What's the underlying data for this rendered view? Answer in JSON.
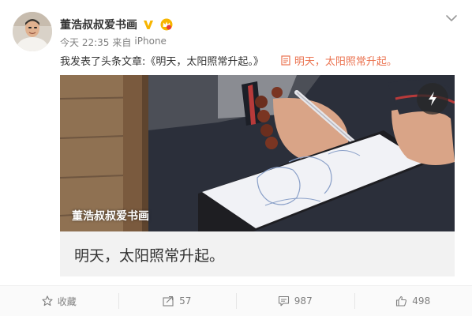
{
  "post": {
    "author": {
      "name": "董浩叔叔爱书画",
      "verified_icon": "v-badge-icon",
      "member_icon": "crown-icon"
    },
    "meta": {
      "time": "今天 22:35",
      "source_prefix": "来自",
      "source": "iPhone"
    },
    "text": "我发表了头条文章:《明天，太阳照常升起。》",
    "article_link": {
      "icon": "article-icon",
      "label": "明天，太阳照常升起。"
    },
    "media": {
      "watermark": "董浩叔叔爱书画",
      "corner_icon": "lightning-icon"
    },
    "article_title": "明天，太阳照常升起。"
  },
  "actions": [
    {
      "icon": "star-icon",
      "label": "收藏"
    },
    {
      "icon": "share-icon",
      "label": "57"
    },
    {
      "icon": "comment-icon",
      "label": "987"
    },
    {
      "icon": "like-icon",
      "label": "498"
    }
  ],
  "colors": {
    "link": "#eb7350",
    "muted": "#808080",
    "text": "#333333",
    "title_bg": "#f2f2f2",
    "vip_gold": "#f7b500"
  }
}
